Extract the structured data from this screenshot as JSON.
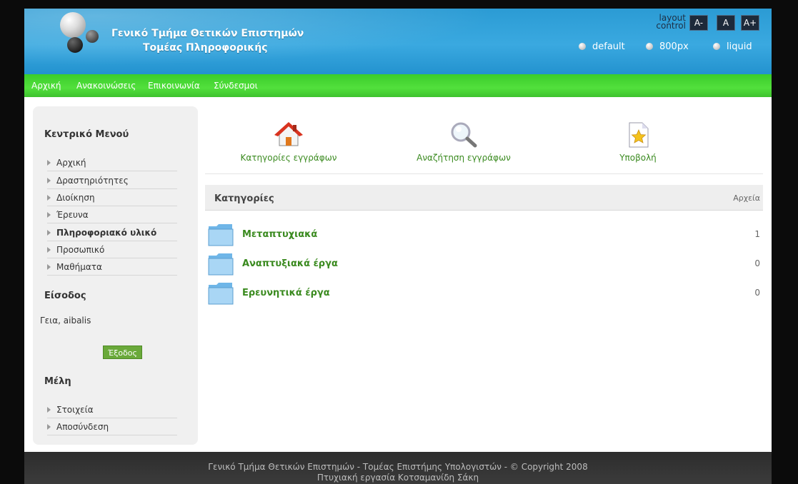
{
  "header": {
    "title_line1": "Γενικό Τμήμα Θετικών Επιστημών",
    "title_line2": "Τομέας Πληροφορικής",
    "layout_control_line1": "layout",
    "layout_control_line2": "control",
    "font_buttons": [
      "A-",
      "A",
      "A+"
    ],
    "layout_options": [
      "default",
      "800px",
      "liquid"
    ]
  },
  "nav": {
    "items": [
      "Αρχική",
      "Ανακοινώσεις",
      "Επικοινωνία",
      "Σύνδεσμοι"
    ]
  },
  "sidebar": {
    "menu_heading": "Κεντρικό Μενού",
    "menu_items": [
      "Αρχική",
      "Δραστηριότητες",
      "Διοίκηση",
      "Έρευνα",
      "Πληροφοριακό υλικό",
      "Προσωπικό",
      "Μαθήματα"
    ],
    "login_heading": "Είσοδος",
    "greeting": "Γεια, aibalis",
    "logout_label": "Έξοδος",
    "members_heading": "Μέλη",
    "member_items": [
      "Στοιχεία",
      "Αποσύνδεση"
    ]
  },
  "main": {
    "icons": [
      {
        "label": "Κατηγορίες εγγράφων",
        "icon": "home-icon"
      },
      {
        "label": "Αναζήτηση εγγράφων",
        "icon": "search-icon"
      },
      {
        "label": "Υποβολή",
        "icon": "document-star-icon"
      }
    ],
    "categories_title": "Κατηγορίες",
    "files_label": "Αρχεία",
    "categories": [
      {
        "name": "Μεταπτυχιακά",
        "count": "1"
      },
      {
        "name": "Αναπτυξιακά έργα",
        "count": "0"
      },
      {
        "name": "Ερευνητικά έργα",
        "count": "0"
      }
    ]
  },
  "footer": {
    "line1": "Γενικό Τμήμα Θετικών Επιστημών - Τομέας Επιστήμης Υπολογιστών - © Copyright 2008",
    "line2": "Πτυχιακή εργασία Κοτσαμανίδη Σάκη"
  },
  "colors": {
    "header_blue": "#2b9bd4",
    "nav_green": "#4bd836",
    "link_green": "#3a8a1f",
    "footer_dark": "#333333"
  }
}
